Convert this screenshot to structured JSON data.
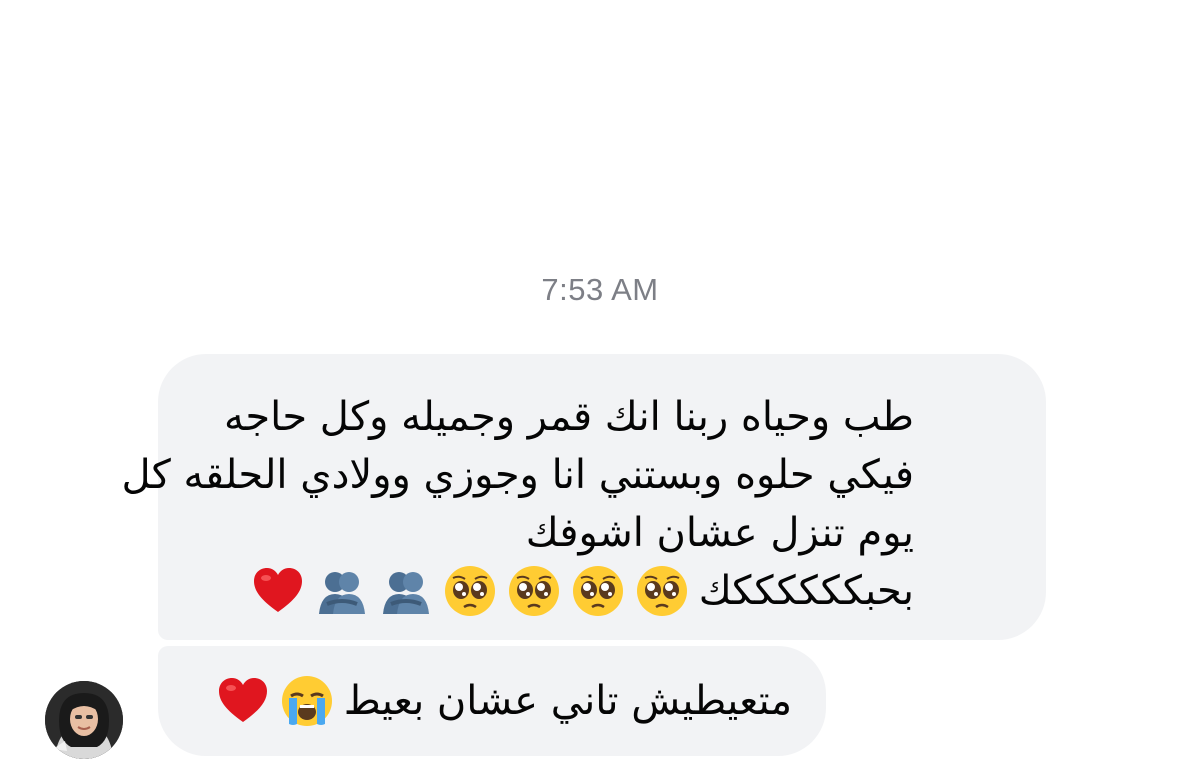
{
  "conversation": {
    "timestamp": "7:53 AM",
    "messages": [
      {
        "lines": [
          "طب وحياه ربنا انك قمر وجميله وكل حاجه",
          "فيكي حلوه وبستني انا وجوزي وولادي الحلقه كل",
          "يوم تنزل عشان اشوفك"
        ],
        "last_line_text": "بحبككككككك",
        "emojis": [
          "pleading-face",
          "pleading-face",
          "pleading-face",
          "pleading-face",
          "people-hugging",
          "people-hugging",
          "red-heart"
        ]
      },
      {
        "text": "متعيطيش تاني عشان بعيط",
        "emojis": [
          "loudly-crying-face",
          "red-heart"
        ]
      }
    ]
  },
  "colors": {
    "bubble_bg": "#f2f3f5",
    "timestamp": "#7d7f86",
    "text": "#050505"
  }
}
